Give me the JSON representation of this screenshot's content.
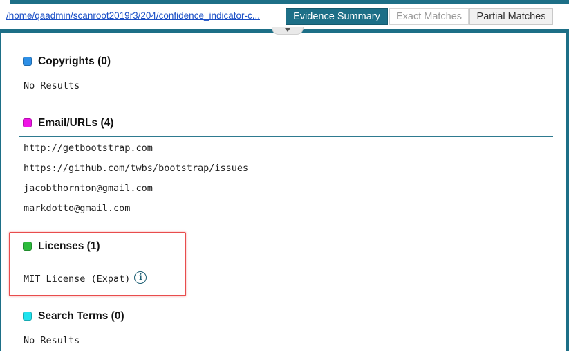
{
  "header": {
    "path": "/home/qaadmin/scanroot2019r3/204/confidence_indicator-c...",
    "tabs": [
      {
        "label": "Evidence Summary",
        "state": "active"
      },
      {
        "label": "Exact Matches",
        "state": "disabled"
      },
      {
        "label": "Partial Matches",
        "state": "normal"
      }
    ]
  },
  "colors": {
    "accent": "#1d6f87",
    "copyrights": "#2d8fe6",
    "email_urls": "#f014e6",
    "licenses": "#2dbb3c",
    "search_terms": "#1fe3ee",
    "highlight": "#e84d4d"
  },
  "sections": {
    "copyrights": {
      "title": "Copyrights (0)",
      "rows": [
        "No Results"
      ]
    },
    "email_urls": {
      "title": "Email/URLs (4)",
      "rows": [
        "http://getbootstrap.com",
        "https://github.com/twbs/bootstrap/issues",
        "jacobthornton@gmail.com",
        "markdotto@gmail.com"
      ]
    },
    "licenses": {
      "title": "Licenses (1)",
      "rows": [
        "MIT License (Expat)"
      ],
      "info_icon": "info-icon"
    },
    "search_terms": {
      "title": "Search Terms (0)",
      "rows": [
        "No Results"
      ]
    }
  }
}
